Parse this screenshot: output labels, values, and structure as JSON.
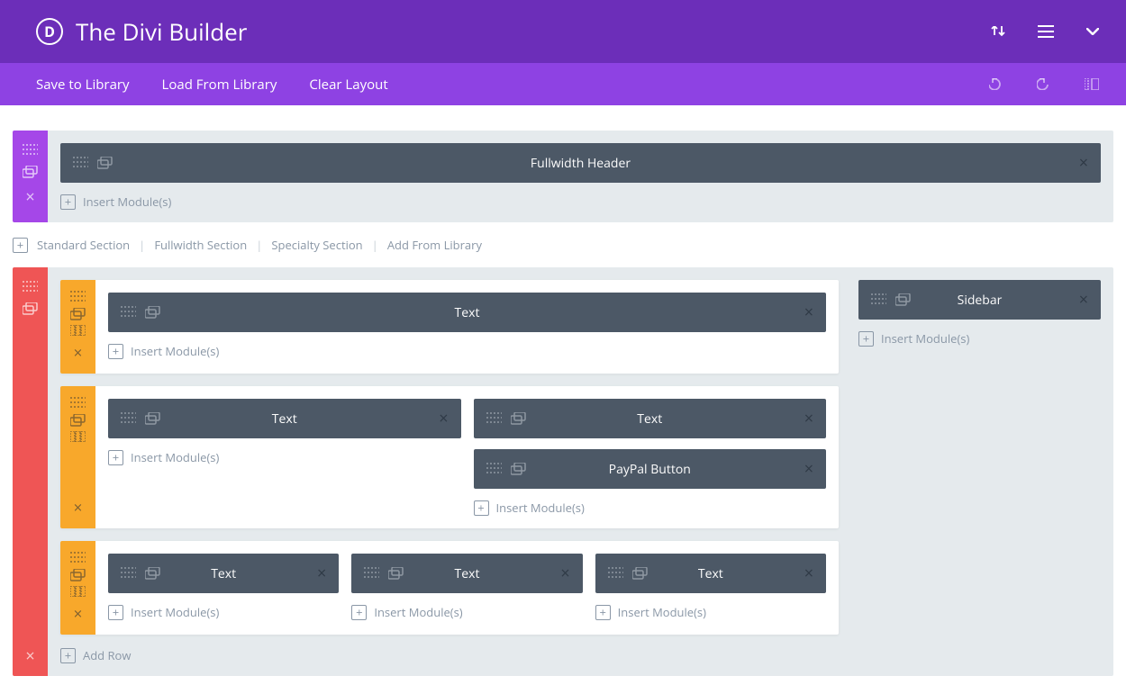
{
  "header": {
    "logo_letter": "D",
    "title": "The Divi Builder"
  },
  "toolbar": {
    "links": [
      "Save to Library",
      "Load From Library",
      "Clear Layout"
    ]
  },
  "addbar": {
    "items": [
      "Standard Section",
      "Fullwidth Section",
      "Specialty Section",
      "Add From Library"
    ]
  },
  "labels": {
    "insert_modules": "Insert Module(s)",
    "add_row": "Add Row"
  },
  "sections": {
    "purple": {
      "modules": [
        {
          "label": "Fullwidth Header"
        }
      ]
    },
    "red": {
      "side": {
        "modules": [
          {
            "label": "Sidebar"
          }
        ]
      },
      "rows": [
        {
          "cols": [
            {
              "modules": [
                {
                  "label": "Text"
                }
              ]
            }
          ]
        },
        {
          "cols": [
            {
              "modules": [
                {
                  "label": "Text"
                }
              ]
            },
            {
              "modules": [
                {
                  "label": "Text"
                },
                {
                  "label": "PayPal Button"
                }
              ]
            }
          ]
        },
        {
          "cols": [
            {
              "modules": [
                {
                  "label": "Text"
                }
              ]
            },
            {
              "modules": [
                {
                  "label": "Text"
                }
              ]
            },
            {
              "modules": [
                {
                  "label": "Text"
                }
              ]
            }
          ]
        }
      ]
    }
  }
}
